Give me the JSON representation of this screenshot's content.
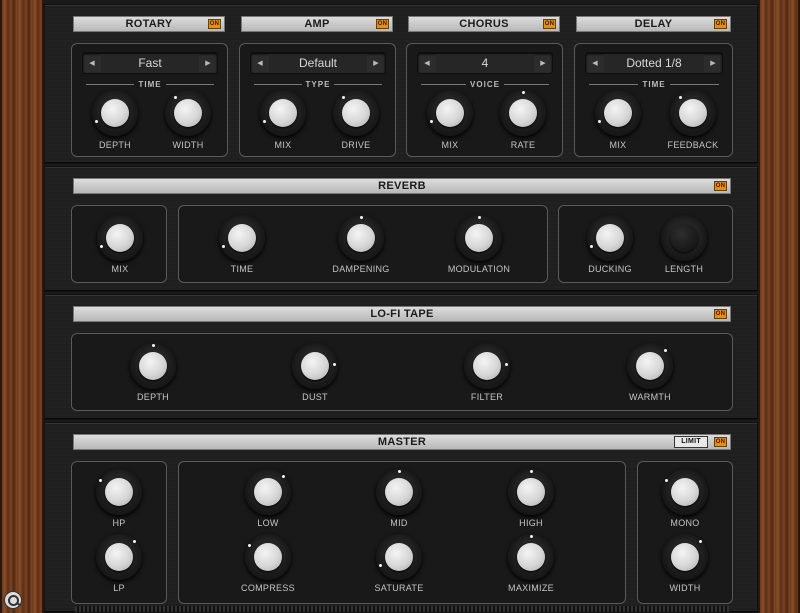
{
  "effects": [
    {
      "title": "ROTARY",
      "on": "ON",
      "selector": "Fast",
      "group": "TIME",
      "knobs": [
        "DEPTH",
        "WIDTH"
      ]
    },
    {
      "title": "AMP",
      "on": "ON",
      "selector": "Default",
      "group": "TYPE",
      "knobs": [
        "MIX",
        "DRIVE"
      ]
    },
    {
      "title": "CHORUS",
      "on": "ON",
      "selector": "4",
      "group": "VOICE",
      "knobs": [
        "MIX",
        "RATE"
      ]
    },
    {
      "title": "DELAY",
      "on": "ON",
      "selector": "Dotted 1/8",
      "group": "TIME",
      "knobs": [
        "MIX",
        "FEEDBACK"
      ]
    }
  ],
  "reverb": {
    "title": "REVERB",
    "on": "ON",
    "knobs": [
      "MIX",
      "TIME",
      "DAMPENING",
      "MODULATION",
      "DUCKING",
      "LENGTH"
    ]
  },
  "lofi": {
    "title": "LO-FI TAPE",
    "on": "ON",
    "knobs": [
      "DEPTH",
      "DUST",
      "FILTER",
      "WARMTH"
    ]
  },
  "master": {
    "title": "MASTER",
    "limit": "LIMIT",
    "on": "ON",
    "left_knobs": [
      "HP",
      "LP"
    ],
    "center_top": [
      "LOW",
      "MID",
      "HIGH"
    ],
    "center_bottom": [
      "COMPRESS",
      "SATURATE",
      "MAXIMIZE"
    ],
    "right_knobs": [
      "MONO",
      "WIDTH"
    ]
  },
  "arrows": {
    "left": "◀",
    "right": "▶"
  },
  "icons": {
    "zoom": "magnifier-icon"
  }
}
